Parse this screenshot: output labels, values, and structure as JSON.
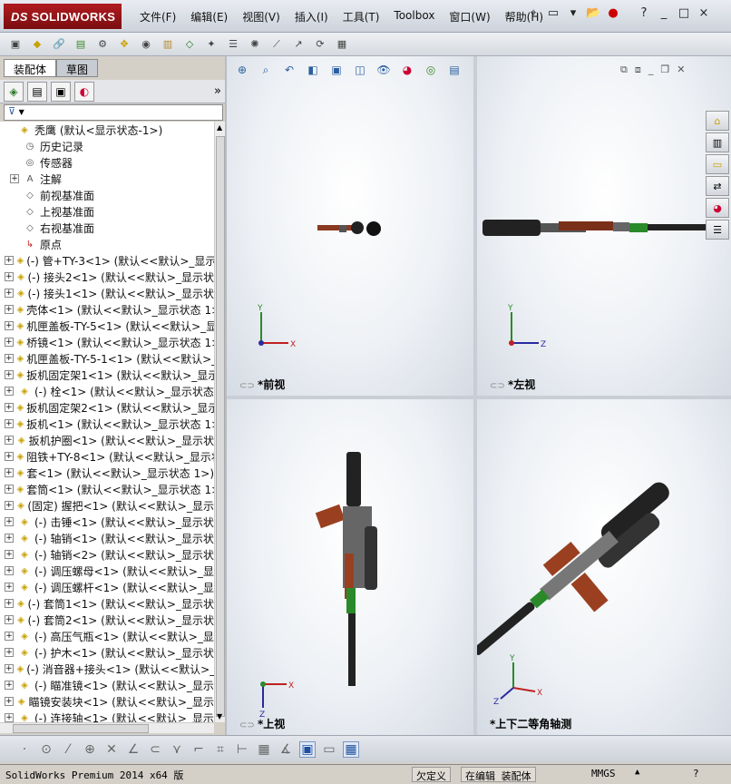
{
  "app": {
    "logo_text": "SOLIDWORKS",
    "logo_prefix": "DS",
    "menus": [
      "文件(F)",
      "编辑(E)",
      "视图(V)",
      "插入(I)",
      "工具(T)",
      "Toolbox",
      "窗口(W)",
      "帮助(H)"
    ],
    "window_controls": [
      "?",
      "_",
      "□",
      "×"
    ]
  },
  "panel": {
    "tabs": [
      "装配体",
      "草图"
    ],
    "active_tab": "装配体",
    "more_icon": "»",
    "filter_icon": "▼"
  },
  "tree": {
    "root": "秃鹰  (默认<显示状态-1>)",
    "fixed_items": [
      {
        "label": "历史记录",
        "icon": "history-icon"
      },
      {
        "label": "传感器",
        "icon": "sensor-icon"
      },
      {
        "label": "注解",
        "icon": "annotation-icon"
      },
      {
        "label": "前视基准面",
        "icon": "plane-icon"
      },
      {
        "label": "上视基准面",
        "icon": "plane-icon"
      },
      {
        "label": "右视基准面",
        "icon": "plane-icon"
      },
      {
        "label": "原点",
        "icon": "origin-icon"
      }
    ],
    "components": [
      "(-) 管+TY-3<1> (默认<<默认>_显示",
      "(-) 接头2<1> (默认<<默认>_显示状",
      "(-) 接头1<1> (默认<<默认>_显示状",
      "壳体<1> (默认<<默认>_显示状态 1>",
      "机匣盖板-TY-5<1> (默认<<默认>_显",
      "桥镜<1> (默认<<默认>_显示状态 1>",
      "机匣盖板-TY-5-1<1> (默认<<默认>_",
      "扳机固定架1<1> (默认<<默认>_显示",
      "(-) 栓<1> (默认<<默认>_显示状态",
      "扳机固定架2<1> (默认<<默认>_显示",
      "扳机<1> (默认<<默认>_显示状态 1>",
      "扳机护圈<1> (默认<<默认>_显示状",
      "阻铁+TY-8<1> (默认<<默认>_显示状",
      "套<1> (默认<<默认>_显示状态 1>)",
      "套筒<1> (默认<<默认>_显示状态 1>",
      "(固定) 握把<1> (默认<<默认>_显示",
      "(-) 击锤<1> (默认<<默认>_显示状",
      "(-) 轴销<1> (默认<<默认>_显示状",
      "(-) 轴销<2> (默认<<默认>_显示状",
      "(-) 调压螺母<1> (默认<<默认>_显",
      "(-) 调压螺杆<1> (默认<<默认>_显",
      "(-) 套筒1<1> (默认<<默认>_显示状",
      "(-) 套筒2<1> (默认<<默认>_显示状",
      "(-) 高压气瓶<1> (默认<<默认>_显",
      "(-) 护木<1> (默认<<默认>_显示状",
      "(-) 消音器+接头<1> (默认<<默认>_",
      "(-) 瞄准镜<1> (默认<<默认>_显示",
      "瞄镜安装块<1> (默认<<默认>_显示",
      "(-) 连接轴<1> (默认<<默认>_显示"
    ]
  },
  "viewports": {
    "front": {
      "label": "*前视",
      "axes": [
        "Y",
        "X"
      ]
    },
    "left": {
      "label": "*左视",
      "axes": [
        "Y",
        "Z"
      ]
    },
    "top": {
      "label": "*上视",
      "axes": [
        "X",
        "Z"
      ]
    },
    "iso": {
      "label": "*上下二等角轴测",
      "axes": [
        "Y",
        "X",
        "Z"
      ]
    }
  },
  "status": {
    "product": "SolidWorks Premium 2014 x64 版",
    "defined": "欠定义",
    "mode": "在编辑 装配体",
    "units": "MMGS",
    "arrow": "▲",
    "help": "?"
  }
}
